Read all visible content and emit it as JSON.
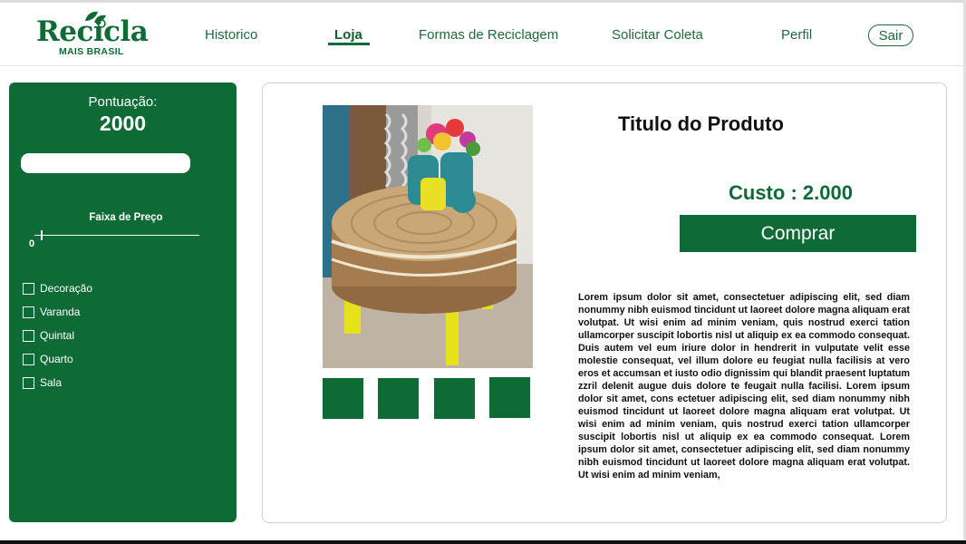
{
  "header": {
    "logo": {
      "wordmark": "Recicla",
      "subtitle": "MAIS BRASIL",
      "icon": "leaf-recycle-icon"
    },
    "nav": [
      {
        "label": "Historico",
        "active": false
      },
      {
        "label": "Loja",
        "active": true
      },
      {
        "label": "Formas de Reciclagem",
        "active": false
      },
      {
        "label": "Solicitar Coleta",
        "active": false
      },
      {
        "label": "Perfil",
        "active": false
      }
    ],
    "logout_label": "Sair"
  },
  "sidebar": {
    "score_label": "Pontuação:",
    "score_value": "2000",
    "search": {
      "value": "",
      "placeholder": ""
    },
    "price_filter": {
      "label": "Faixa de Preço",
      "min_label": "0",
      "level": 0.05
    },
    "categories": [
      {
        "label": "Decoração",
        "checked": false
      },
      {
        "label": "Varanda",
        "checked": false
      },
      {
        "label": "Quintal",
        "checked": false
      },
      {
        "label": "Quarto",
        "checked": false
      },
      {
        "label": "Sala",
        "checked": false
      }
    ]
  },
  "product": {
    "title": "Titulo do Produto",
    "price": "Custo : 2.000",
    "buy_label": "Comprar",
    "image": "tire-ottoman-product-photo",
    "thumbnail_count": 4,
    "description": "Lorem ipsum dolor sit amet, consectetuer adipiscing elit, sed diam nonummy nibh euismod tincidunt ut laoreet dolore magna aliquam erat volutpat. Ut wisi enim ad minim veniam, quis nostrud exerci tation ullamcorper suscipit lobortis nisl ut aliquip ex ea commodo consequat. Duis autem vel eum iriure dolor in hendrerit in vulputate velit esse molestie consequat, vel illum dolore eu feugiat nulla facilisis at vero eros et accumsan et iusto odio dignissim qui blandit praesent luptatum zzril delenit augue duis dolore te feugait nulla facilisi. Lorem ipsum dolor sit amet, cons ectetuer adipiscing elit, sed diam nonummy nibh euismod tincidunt ut laoreet dolore magna aliquam erat volutpat. Ut wisi enim ad minim veniam, quis nostrud exerci tation ullamcorper suscipit lobortis nisl ut aliquip ex ea commodo consequat. Lorem ipsum dolor sit amet, consectetuer adipiscing elit, sed diam nonummy nibh euismod tincidunt ut laoreet dolore magna aliquam erat volutpat. Ut wisi enim ad minim veniam,"
  },
  "colors": {
    "brand_green": "#0f6b35",
    "text_dark": "#111111",
    "card_border": "#cfcfcf"
  }
}
